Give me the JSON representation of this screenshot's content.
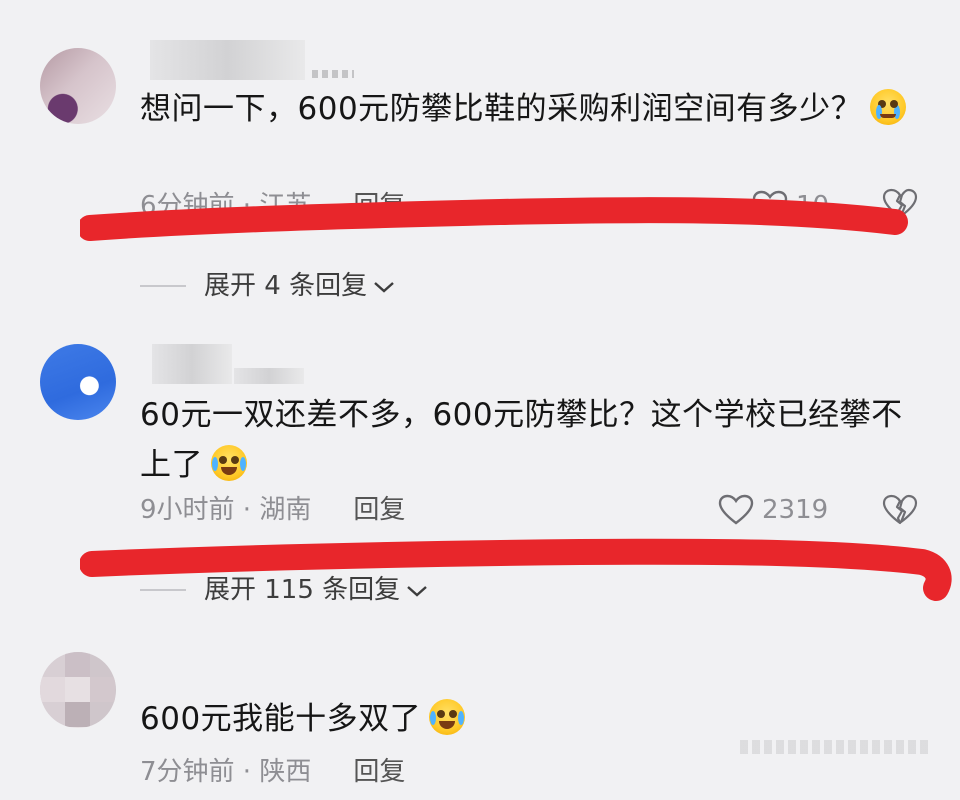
{
  "comments": [
    {
      "text": "想问一下，600元防攀比鞋的采购利润空间有多少？",
      "emoji": "crying-face",
      "time": "6分钟前",
      "location": "江苏",
      "reply_label": "回复",
      "likes": "10",
      "expand_label": "展开 4 条回复"
    },
    {
      "text": "60元一双还差不多，600元防攀比？这个学校已经攀不上了",
      "emoji": "laughing-tears-face",
      "time": "9小时前",
      "location": "湖南",
      "reply_label": "回复",
      "likes": "2319",
      "expand_label": "展开 115 条回复"
    },
    {
      "text": "600元我能十多双了",
      "emoji": "laughing-tears-face",
      "time": "7分钟前",
      "location": "陕西",
      "reply_label": "回复"
    }
  ],
  "separator": " · ",
  "colors": {
    "background": "#f1f1f3",
    "red_marker": "#e8262b",
    "meta_text": "#8e8e93"
  }
}
